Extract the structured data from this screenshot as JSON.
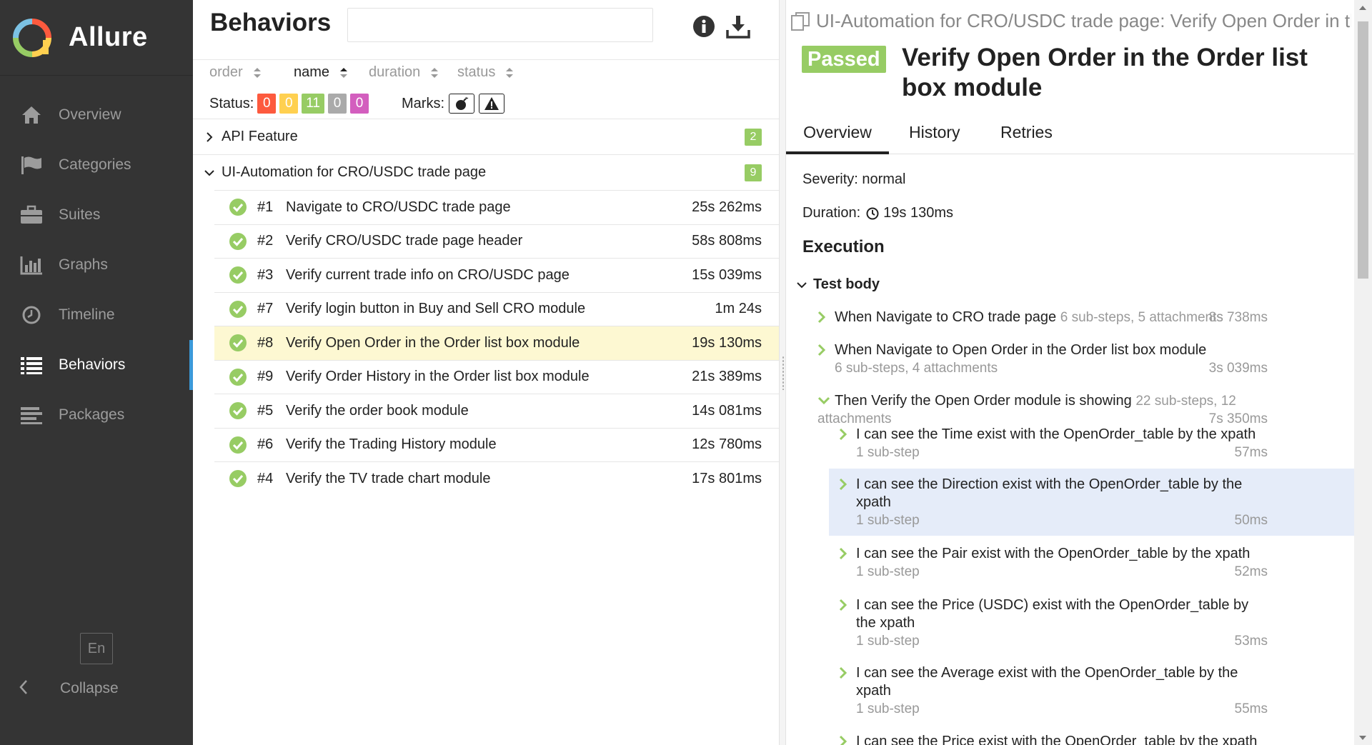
{
  "app": {
    "name": "Allure"
  },
  "sidebar": {
    "items": [
      {
        "label": "Overview",
        "icon": "home-icon"
      },
      {
        "label": "Categories",
        "icon": "flag-icon"
      },
      {
        "label": "Suites",
        "icon": "briefcase-icon"
      },
      {
        "label": "Graphs",
        "icon": "bar-chart-icon"
      },
      {
        "label": "Timeline",
        "icon": "clock-icon"
      },
      {
        "label": "Behaviors",
        "icon": "list-icon",
        "active": true
      },
      {
        "label": "Packages",
        "icon": "align-left-icon"
      }
    ],
    "language": "En",
    "collapse_label": "Collapse"
  },
  "behaviors": {
    "title": "Behaviors",
    "search_value": "",
    "sorters": [
      {
        "label": "order"
      },
      {
        "label": "name",
        "active": true
      },
      {
        "label": "duration"
      },
      {
        "label": "status"
      }
    ],
    "status_label": "Status:",
    "status_counts": [
      {
        "value": "0",
        "color": "#fd5a3e"
      },
      {
        "value": "0",
        "color": "#ffd050"
      },
      {
        "value": "11",
        "color": "#97cc64"
      },
      {
        "value": "0",
        "color": "#aaaaaa"
      },
      {
        "value": "0",
        "color": "#d35ebe"
      }
    ],
    "marks_label": "Marks:",
    "groups": [
      {
        "name": "API Feature",
        "count": "2",
        "expanded": false
      },
      {
        "name": "UI-Automation for CRO/USDC trade page",
        "count": "9",
        "expanded": true
      }
    ],
    "cases": [
      {
        "num": "#1",
        "name": "Navigate to CRO/USDC trade page",
        "duration": "25s 262ms"
      },
      {
        "num": "#2",
        "name": "Verify CRO/USDC trade page header",
        "duration": "58s 808ms"
      },
      {
        "num": "#3",
        "name": "Verify current trade info on CRO/USDC page",
        "duration": "15s 039ms"
      },
      {
        "num": "#7",
        "name": "Verify login button in Buy and Sell CRO module",
        "duration": "1m 24s"
      },
      {
        "num": "#8",
        "name": "Verify Open Order in the Order list box module",
        "duration": "19s 130ms",
        "selected": true
      },
      {
        "num": "#9",
        "name": "Verify Order History in the Order list box module",
        "duration": "21s 389ms"
      },
      {
        "num": "#5",
        "name": "Verify the order book module",
        "duration": "14s 081ms"
      },
      {
        "num": "#6",
        "name": "Verify the Trading History module",
        "duration": "12s 780ms"
      },
      {
        "num": "#4",
        "name": "Verify the TV trade chart module",
        "duration": "17s 801ms"
      }
    ]
  },
  "detail": {
    "path": "UI-Automation for CRO/USDC trade page: Verify Open Order in the Order list box module",
    "status": "Passed",
    "title": "Verify Open Order in the Order list box module",
    "tabs": [
      "Overview",
      "History",
      "Retries"
    ],
    "severity": "Severity: normal",
    "duration_label": "Duration:",
    "duration": "19s 130ms",
    "execution_title": "Execution",
    "test_body_label": "Test body",
    "steps": [
      {
        "title": "When Navigate to CRO trade page",
        "sub": "6 sub-steps, 5 attachments",
        "duration": "8s 738ms"
      },
      {
        "title": "When Navigate to Open Order in the Order list box module",
        "sub": "6 sub-steps, 4 attachments",
        "duration": "3s 039ms"
      },
      {
        "title": "Then Verify the Open Order module is showing",
        "sub": "22 sub-steps, 12 attachments",
        "duration": "7s 350ms"
      }
    ],
    "substeps": [
      {
        "title1": "I can see the Time exist with the OpenOrder_table by the xpath",
        "title2": "",
        "sub": "1 sub-step",
        "duration": "57ms"
      },
      {
        "title1": "I can see the Direction exist with the OpenOrder_table by the",
        "title2": "xpath",
        "sub": "1 sub-step",
        "duration": "50ms"
      },
      {
        "title1": "I can see the Pair exist with the OpenOrder_table by the xpath",
        "title2": "",
        "sub": "1 sub-step",
        "duration": "52ms"
      },
      {
        "title1": "I can see the Price (USDC) exist with the OpenOrder_table by",
        "title2": "the xpath",
        "sub": "1 sub-step",
        "duration": "53ms"
      },
      {
        "title1": "I can see the Average exist with the OpenOrder_table by the",
        "title2": "xpath",
        "sub": "1 sub-step",
        "duration": "55ms"
      },
      {
        "title1": "I can see the Price exist with the OpenOrder_table by the xpath",
        "title2": "",
        "sub": "",
        "duration": ""
      }
    ]
  }
}
